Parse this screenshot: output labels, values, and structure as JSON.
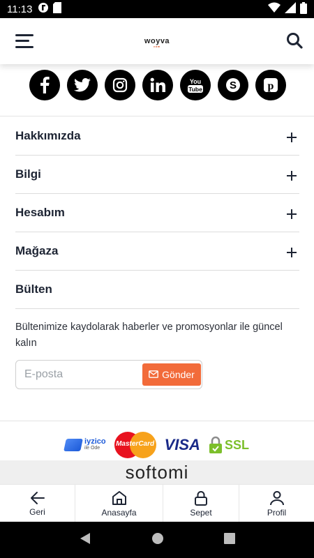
{
  "status_bar": {
    "time": "11:13"
  },
  "header": {
    "logo_text": "woyva",
    "logo_sub": "com"
  },
  "social": [
    "facebook-icon",
    "twitter-icon",
    "instagram-icon",
    "linkedin-icon",
    "youtube-icon",
    "skype-icon",
    "pinterest-icon"
  ],
  "footer_menu": [
    {
      "label": "Hakkımızda"
    },
    {
      "label": "Bilgi"
    },
    {
      "label": "Hesabım"
    },
    {
      "label": "Mağaza"
    },
    {
      "label": "Bülten"
    }
  ],
  "newsletter": {
    "text": "Bültenimize kaydolarak haberler ve promosyonlar ile güncel kalın",
    "placeholder": "E-posta",
    "button_label": "Gönder"
  },
  "payments": {
    "iyzico": "iyzico",
    "iyzico_sub": "ile Öde",
    "mastercard": "MasterCard",
    "visa": "VISA",
    "ssl": "SSL"
  },
  "brand_bar": {
    "text": "softomi"
  },
  "bottom_nav": [
    {
      "label": "Geri",
      "icon": "arrow-left-icon"
    },
    {
      "label": "Anasayfa",
      "icon": "home-icon"
    },
    {
      "label": "Sepet",
      "icon": "lock-icon"
    },
    {
      "label": "Profil",
      "icon": "user-icon"
    }
  ],
  "colors": {
    "accent": "#f26b3a",
    "text": "#1d2433"
  }
}
